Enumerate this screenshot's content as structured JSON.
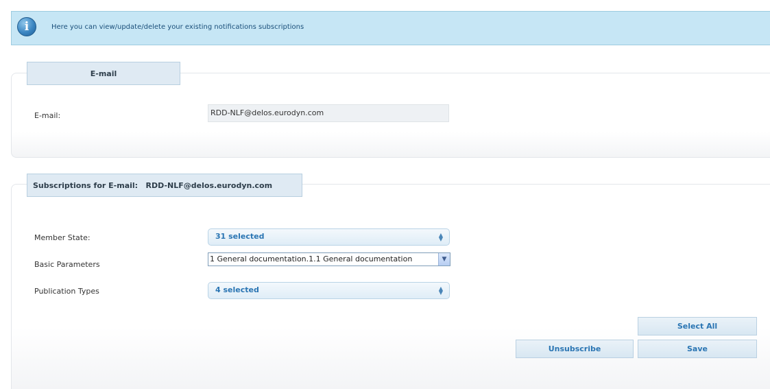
{
  "info_banner": {
    "icon": "info-icon",
    "icon_glyph": "i",
    "text": "Here you can view/update/delete your existing notifications subscriptions"
  },
  "email_panel": {
    "tab_title": "E-mail",
    "label": "E-mail:",
    "value": "RDD-NLF@delos.eurodyn.com"
  },
  "subscriptions_panel": {
    "tab_title": "Subscriptions for E-mail:   RDD-NLF@delos.eurodyn.com",
    "member_state": {
      "label": "Member State:",
      "selected": "31 selected"
    },
    "basic_parameters": {
      "label": "Basic Parameters",
      "selected": "1 General documentation.1.1 General documentation"
    },
    "publication_types": {
      "label": "Publication Types",
      "selected": "4 selected"
    }
  },
  "buttons": {
    "select_all": "Select All",
    "unsubscribe": "Unsubscribe",
    "save": "Save"
  },
  "colors": {
    "banner_bg": "#c6e6f5",
    "tab_bg": "#dfeaf3",
    "accent_text": "#2a75b3"
  }
}
